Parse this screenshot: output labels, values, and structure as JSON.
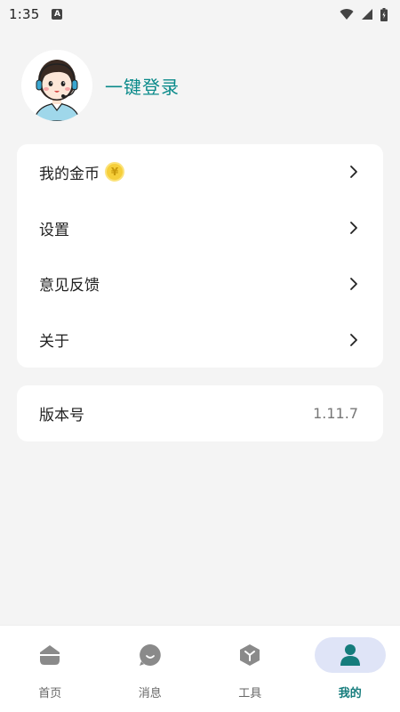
{
  "status_bar": {
    "time": "1:35",
    "app_icon_letter": "A"
  },
  "profile": {
    "login_text": "一键登录"
  },
  "menu": {
    "items": [
      {
        "label": "我的金币",
        "badge": "¥"
      },
      {
        "label": "设置"
      },
      {
        "label": "意见反馈"
      },
      {
        "label": "关于"
      }
    ]
  },
  "version": {
    "label": "版本号",
    "value": "1.11.7"
  },
  "tabs": [
    {
      "label": "首页",
      "icon": "home-icon",
      "active": false
    },
    {
      "label": "消息",
      "icon": "message-icon",
      "active": false
    },
    {
      "label": "工具",
      "icon": "tools-icon",
      "active": false
    },
    {
      "label": "我的",
      "icon": "profile-icon",
      "active": true
    }
  ],
  "colors": {
    "accent": "#0a8a8a",
    "active_tab_bg": "#dfe4f7",
    "background": "#f4f4f4",
    "coin": "#f6cf3a"
  }
}
